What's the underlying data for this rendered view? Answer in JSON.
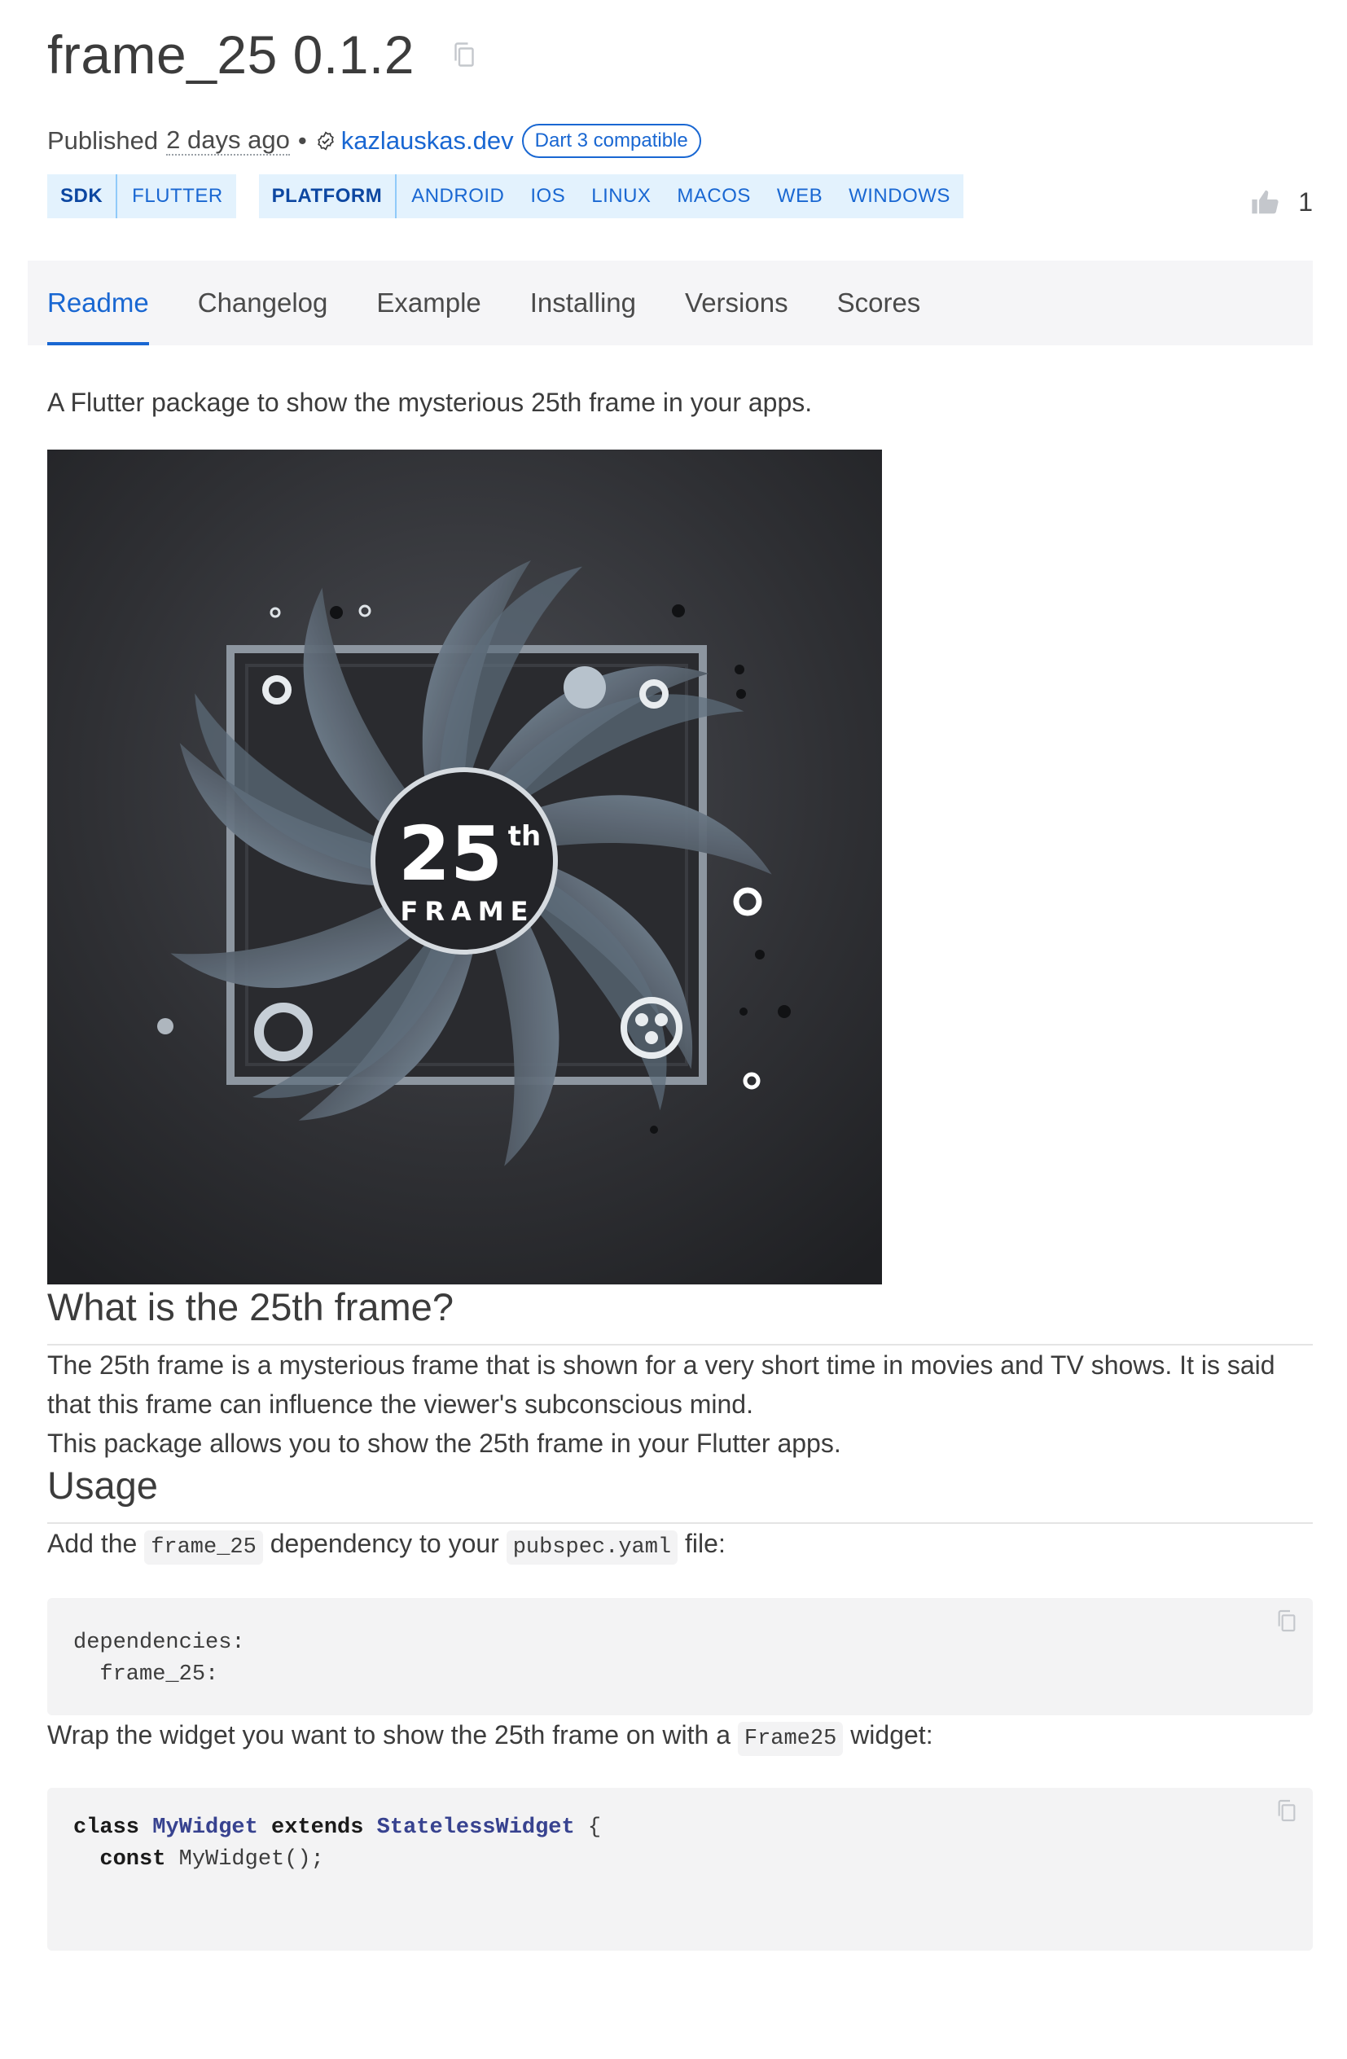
{
  "header": {
    "package_title": "frame_25 0.1.2",
    "published_label": "Published",
    "published_date": "2 days ago",
    "dot": "•",
    "publisher": "kazlauskas.dev",
    "dart3_badge": "Dart 3 compatible",
    "like_count": "1"
  },
  "tags": {
    "sdk": {
      "label": "SDK",
      "values": [
        "FLUTTER"
      ]
    },
    "platform": {
      "label": "PLATFORM",
      "values": [
        "ANDROID",
        "IOS",
        "LINUX",
        "MACOS",
        "WEB",
        "WINDOWS"
      ]
    }
  },
  "tabs": [
    {
      "label": "Readme",
      "active": true
    },
    {
      "label": "Changelog"
    },
    {
      "label": "Example"
    },
    {
      "label": "Installing"
    },
    {
      "label": "Versions"
    },
    {
      "label": "Scores"
    }
  ],
  "readme": {
    "intro": "A Flutter package to show the mysterious 25th frame in your apps.",
    "hero_image": {
      "big_number": "25",
      "superscript": "th",
      "word": "FRAME"
    },
    "what_heading": "What is the 25th frame?",
    "what_p1": "The 25th frame is a mysterious frame that is shown for a very short time in movies and TV shows. It is said that this frame can influence the viewer's subconscious mind.",
    "what_p2": "This package allows you to show the 25th frame in your Flutter apps.",
    "usage_heading": "Usage",
    "usage_p1": {
      "t1": "Add the ",
      "code1": "frame_25",
      "t2": " dependency to your ",
      "code2": "pubspec.yaml",
      "t3": " file:"
    },
    "code_block_1": {
      "line1": "dependencies:",
      "line2": "  frame_25:"
    },
    "usage_p2": {
      "t1": "Wrap the widget you want to show the 25th frame on with a ",
      "code1": "Frame25",
      "t2": " widget:"
    },
    "code_block_2": {
      "kw_class": "class",
      "cls_mywidget": "MyWidget",
      "kw_extends": "extends",
      "cls_stateless": "StatelessWidget",
      "brace": " {",
      "indent": "  ",
      "kw_const": "const",
      "ctor": " MyWidget();"
    }
  },
  "icons": {
    "copy": "copy-icon",
    "verified": "verified-publisher-icon",
    "like": "thumb-up-icon"
  },
  "colors": {
    "accent": "#1967d2",
    "tag_bg": "#e3f2fd",
    "tabs_bg": "#f5f5f7",
    "code_bg": "#f3f3f4"
  }
}
